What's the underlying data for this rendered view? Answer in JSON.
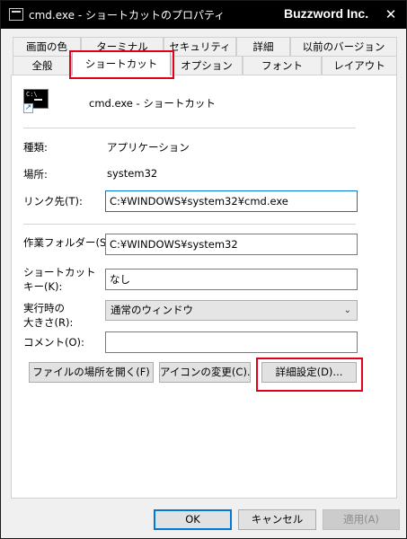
{
  "window": {
    "title": "cmd.exe - ショートカットのプロパティ",
    "brand": "Buzzword Inc.",
    "close_glyph": "✕"
  },
  "tabs_row1": [
    "画面の色",
    "ターミナル",
    "セキュリティ",
    "詳細",
    "以前のバージョン"
  ],
  "tabs_row2": [
    "全般",
    "ショートカット",
    "オプション",
    "フォント",
    "レイアウト"
  ],
  "active_tab": "ショートカット",
  "shortcut": {
    "name": "cmd.exe - ショートカット"
  },
  "fields": {
    "type_label": "種類:",
    "type_value": "アプリケーション",
    "location_label": "場所:",
    "location_value": "system32",
    "target_label": "リンク先(T):",
    "target_value": "C:¥WINDOWS¥system32¥cmd.exe",
    "startin_label": "作業フォルダー(S):",
    "startin_value": "C:¥WINDOWS¥system32",
    "hotkey_label_line1": "ショートカット",
    "hotkey_label_line2": "キー(K):",
    "hotkey_value": "なし",
    "run_label_line1": "実行時の",
    "run_label_line2": "大きさ(R):",
    "run_value": "通常のウィンドウ",
    "comment_label": "コメント(O):",
    "comment_value": ""
  },
  "buttons": {
    "open_location": "ファイルの場所を開く(F)",
    "change_icon": "アイコンの変更(C)...",
    "advanced": "詳細設定(D)...",
    "ok": "OK",
    "cancel": "キャンセル",
    "apply": "適用(A)"
  },
  "colors": {
    "highlight": "#e3001f",
    "focus_border": "#0078d7"
  }
}
